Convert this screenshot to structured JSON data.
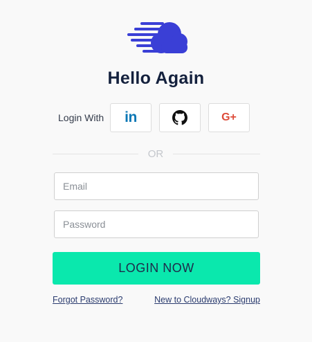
{
  "logo": {
    "icon": "cloudways-cloud-logo-icon",
    "color": "#3a3fd6"
  },
  "title": "Hello Again",
  "social": {
    "label": "Login With",
    "buttons": [
      {
        "icon": "linkedin-icon",
        "text": "in",
        "color": "#0b77b5"
      },
      {
        "icon": "github-icon",
        "color": "#111111"
      },
      {
        "icon": "google-plus-icon",
        "text": "G+",
        "color": "#dd4b39"
      }
    ]
  },
  "divider_text": "OR",
  "form": {
    "email_placeholder": "Email",
    "password_placeholder": "Password",
    "submit_label": "LOGIN NOW",
    "submit_color": "#0ae8ad"
  },
  "links": {
    "forgot": "Forgot Password?",
    "signup": "New to Cloudways? Signup"
  }
}
